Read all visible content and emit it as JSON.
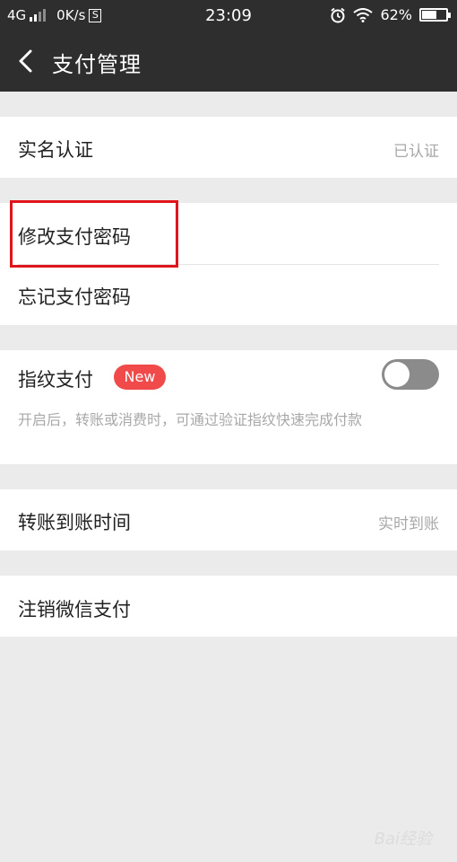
{
  "status_bar": {
    "network": "4G",
    "speed": "0K/s",
    "s_icon_label": "S",
    "time": "23:09",
    "battery_percent": "62%",
    "battery_level": 0.62,
    "alarm_icon": "alarm-icon",
    "wifi_icon": "wifi-icon"
  },
  "header": {
    "back_icon": "chevron-left-icon",
    "title": "支付管理"
  },
  "sections": {
    "real_name": {
      "label": "实名认证",
      "value": "已认证"
    },
    "change_password": {
      "label": "修改支付密码"
    },
    "forgot_password": {
      "label": "忘记支付密码"
    },
    "fingerprint": {
      "label": "指纹支付",
      "badge": "New",
      "toggle_on": false,
      "description": "开启后，转账或消费时，可通过验证指纹快速完成付款"
    },
    "transfer_time": {
      "label": "转账到账时间",
      "value": "实时到账"
    },
    "close_pay": {
      "label": "注销微信支付"
    }
  },
  "colors": {
    "header_bg": "#2e2e2e",
    "page_bg": "#ebebeb",
    "highlight": "#e0141b",
    "badge_bg": "#f04a4a",
    "toggle_off": "#8b8b8b"
  },
  "watermark": "Bai经验"
}
